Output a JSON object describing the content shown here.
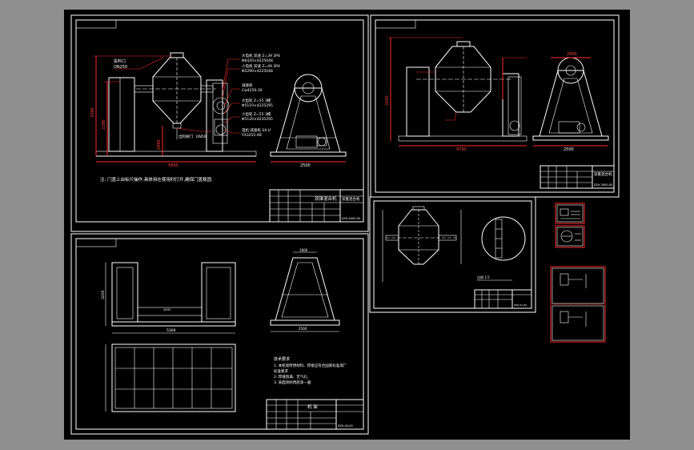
{
  "sheet1": {
    "callout_feed_port": "投料口",
    "callout_feed_port_sub": "DN250",
    "callout_motor1_a": "大电机 双速 Z=39 3P4",
    "callout_motor1_b": "Φ6420×4225048",
    "callout_motor2_a": "小电机 双速 Z=49 3P4",
    "callout_motor2_b": "Φ5290×4225048",
    "callout_reducer": "减速机",
    "callout_reducer_sub": "Cw4250-30",
    "callout_gear1_a": "大齿轮 Z=55 3模",
    "callout_gear1_b": "Φ5110×4225295",
    "callout_gear2_a": "小齿轮 Z=55 3模",
    "callout_gear2_b": "Φ5120×4235295",
    "callout_bearing_a": "电机 减速机 SX-U",
    "callout_bearing_b": "YX3255-4B",
    "callout_discharge": "出料阀门",
    "callout_discharge_sub": "DN50",
    "dim_width": "2990",
    "dim_height": "3390",
    "dim_sub_height": "2290",
    "dim_base": "5890",
    "dim_frame_width": "2500",
    "note": "注: 门盖上由标尺操作,具体用在使用时打开,确保门盖稳固.",
    "title_block_name": "双锥混合机",
    "title_block_code": "SZH-4000-00"
  },
  "sheet2": {
    "dim_top": "2900",
    "dim_height": "3200",
    "dim_base": "4790",
    "dim_frame": "2500",
    "title_block_name": "双锥混合机",
    "title_block_code": "SZH-3000-00"
  },
  "sheet3": {
    "dim_frame_width": "5300",
    "dim_inner": "4500",
    "dim_height": "3200",
    "dim_right_top": "1600",
    "dim_right_base": "2500",
    "tech_title": "技术要求",
    "tech_1": "1. 本机架所用材料、焊接应符合国家标准或厂",
    "tech_1b": "标准要求",
    "tech_2": "2. 焊缝饱满、无气孔;",
    "tech_3": "3. 表面涂防锈底漆一遍.",
    "title_block_name": "机 架",
    "title_block_code": "SZH-00-00"
  },
  "sheet4": {
    "scale_note": "比例 1:5",
    "title_block_code": "SZH-01-00"
  }
}
